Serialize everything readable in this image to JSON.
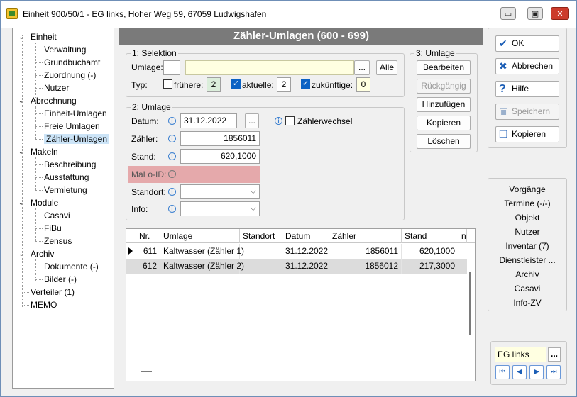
{
  "window": {
    "title": "Einheit 900/50/1 - EG links, Hoher Weg 59, 67059 Ludwigshafen",
    "min_glyph": "▭",
    "max_glyph": "▣",
    "close_glyph": "✕"
  },
  "tree": {
    "nodes": [
      {
        "label": "Einheit",
        "toggle": "⌄"
      },
      {
        "label": "Verwaltung"
      },
      {
        "label": "Grundbuchamt"
      },
      {
        "label": "Zuordnung (-)"
      },
      {
        "label": "Nutzer"
      },
      {
        "label": "Abrechnung",
        "toggle": "⌄"
      },
      {
        "label": "Einheit-Umlagen"
      },
      {
        "label": "Freie Umlagen"
      },
      {
        "label": "Zähler-Umlagen",
        "selected": true
      },
      {
        "label": "Makeln",
        "toggle": "⌄"
      },
      {
        "label": "Beschreibung"
      },
      {
        "label": "Ausstattung"
      },
      {
        "label": "Vermietung"
      },
      {
        "label": "Module",
        "toggle": "⌄"
      },
      {
        "label": "Casavi"
      },
      {
        "label": "FiBu"
      },
      {
        "label": "Zensus"
      },
      {
        "label": "Archiv",
        "toggle": "⌄"
      },
      {
        "label": "Dokumente (-)"
      },
      {
        "label": "Bilder (-)"
      },
      {
        "label": "Verteiler (1)"
      },
      {
        "label": "MEMO"
      }
    ]
  },
  "header": {
    "title": "Zähler-Umlagen  (600 - 699)"
  },
  "selektion": {
    "group_title": "1: Selektion",
    "umlage_label": "Umlage:",
    "umlage_code": "",
    "umlage_name": "",
    "dots_label": "...",
    "alle_label": "Alle",
    "typ_label": "Typ:",
    "fruehere_label": "frühere:",
    "fruehere_value": "2",
    "aktuelle_label": "aktuelle:",
    "aktuelle_value": "2",
    "zukuenftige_label": "zukünftige:",
    "zukuenftige_value": "0",
    "check_glyph": "✓"
  },
  "umlage_section": {
    "group_title": "3: Umlage",
    "bearbeiten": "Bearbeiten",
    "rueckgaengig": "Rückgängig",
    "hinzufuegen": "Hinzufügen",
    "kopieren": "Kopieren",
    "loeschen": "Löschen"
  },
  "umlage_form": {
    "group_title": "2: Umlage",
    "info_glyph": "i",
    "datum_label": "Datum:",
    "datum_value": "31.12.2022",
    "dots_label": "...",
    "zaehlerwechsel_label": "Zählerwechsel",
    "zaehler_label": "Zähler:",
    "zaehler_value": "1856011",
    "stand_label": "Stand:",
    "stand_value": "620,1000",
    "malo_label": "MaLo-ID:",
    "standort_label": "Standort:",
    "standort_value": "",
    "info_field_label": "Info:",
    "info_value": "",
    "dropdown_glyph": "⌵"
  },
  "table": {
    "columns": [
      "Nr.",
      "Umlage",
      "Standort",
      "Datum",
      "Zähler",
      "Stand",
      "n"
    ],
    "rows": [
      {
        "nr": "611",
        "umlage": "Kaltwasser (Zähler 1)",
        "standort": "",
        "datum": "31.12.2022",
        "zaehler": "1856011",
        "stand": "620,1000"
      },
      {
        "nr": "612",
        "umlage": "Kaltwasser (Zähler 2)",
        "standort": "",
        "datum": "31.12.2022",
        "zaehler": "1856012",
        "stand": "217,3000"
      }
    ]
  },
  "actions": {
    "ok": "OK",
    "abbrechen": "Abbrechen",
    "hilfe": "Hilfe",
    "speichern": "Speichern",
    "kopieren": "Kopieren",
    "ok_icon": "✔",
    "abbrechen_icon": "✖",
    "hilfe_icon": "?",
    "speichern_icon": "▣",
    "kopieren_icon": "❐"
  },
  "nav_links": [
    "Vorgänge",
    "Termine (-/-)",
    "Objekt",
    "Nutzer",
    "Inventar (7)",
    "Dienstleister ...",
    "Archiv",
    "Casavi",
    "Info-ZV"
  ],
  "bottom": {
    "unit": "EG links",
    "dots": "...",
    "first": "⏮",
    "prev": "◀",
    "next": "▶",
    "last": "⏭"
  }
}
